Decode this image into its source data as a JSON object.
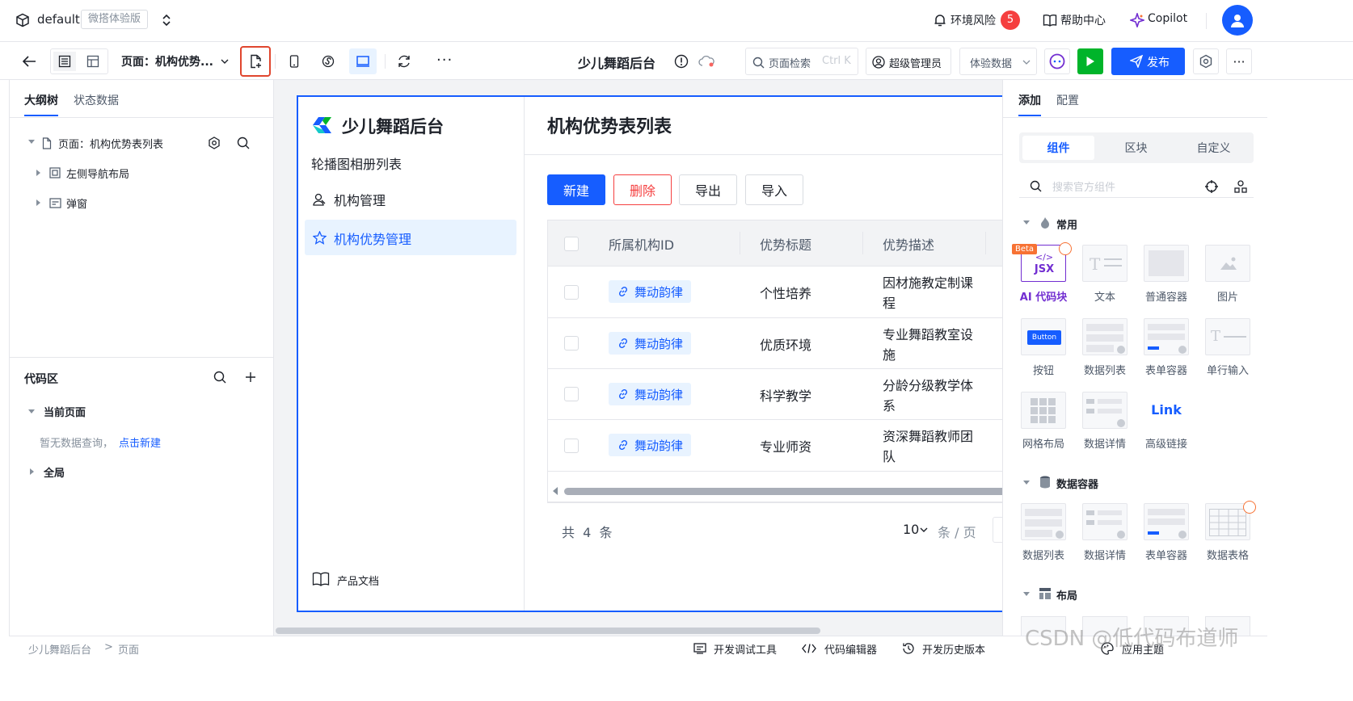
{
  "topbar": {
    "env_name": "default",
    "env_badge": "微搭体验版",
    "risk_label": "环境风险",
    "risk_count": "5",
    "help_label": "帮助中心",
    "copilot_label": "Copilot",
    "brand_color": "#165dff",
    "danger_color": "#f53f3f"
  },
  "toolbar": {
    "page_select": "页面：机构优势...",
    "app_title": "少儿舞蹈后台",
    "search_placeholder": "页面检索",
    "search_shortcut": "Ctrl K",
    "role_label": "超级管理员",
    "data_mode": "体验数据",
    "publish_label": "发布",
    "more": "···"
  },
  "left": {
    "tabs": [
      "大纲树",
      "状态数据"
    ],
    "tree_page": "页面：机构优势表列表",
    "tree_items": [
      "左侧导航布局",
      "弹窗"
    ],
    "code_title": "代码区",
    "current_page": "当前页面",
    "empty_hint": "暂无数据查询，",
    "empty_link": "点击新建",
    "global_label": "全局"
  },
  "preview": {
    "logo_text": "少儿舞蹈后台",
    "nav": [
      "轮播图相册列表",
      "机构管理",
      "机构优势管理"
    ],
    "doc_link": "产品文档",
    "page_title": "机构优势表列表",
    "actions": {
      "new": "新建",
      "delete": "删除",
      "export": "导出",
      "import": "导入"
    },
    "columns": [
      "所属机构ID",
      "优势标题",
      "优势描述"
    ],
    "rows": [
      {
        "org": "舞动韵律",
        "title": "个性培养",
        "desc1": "因材施教定制课",
        "desc2": "程"
      },
      {
        "org": "舞动韵律",
        "title": "优质环境",
        "desc1": "专业舞蹈教室设",
        "desc2": "施"
      },
      {
        "org": "舞动韵律",
        "title": "科学教学",
        "desc1": "分龄分级教学体",
        "desc2": "系"
      },
      {
        "org": "舞动韵律",
        "title": "专业师资",
        "desc1": "资深舞蹈教师团",
        "desc2": "队"
      }
    ],
    "total": "共  4  条",
    "page_size": "10",
    "page_unit": "条 / 页"
  },
  "right": {
    "tabs": [
      "添加",
      "配置"
    ],
    "seg": [
      "组件",
      "区块",
      "自定义"
    ],
    "search_placeholder": "搜索官方组件",
    "group_common": "常用",
    "group_data": "数据容器",
    "group_layout": "布局",
    "common": [
      "AI 代码块",
      "文本",
      "普通容器",
      "图片",
      "按钮",
      "数据列表",
      "表单容器",
      "单行输入",
      "网格布局",
      "数据详情",
      "高级链接"
    ],
    "data": [
      "数据列表",
      "数据详情",
      "表单容器",
      "数据表格"
    ],
    "beta": "Beta",
    "jsx": "JSX",
    "button_thumb": "Button",
    "link_thumb": "Link"
  },
  "status": {
    "breadcrumb": [
      "少儿舞蹈后台",
      "页面"
    ],
    "tools": [
      "开发调试工具",
      "代码编辑器",
      "开发历史版本",
      "应用主题"
    ],
    "watermark": "CSDN @低代码布道师"
  }
}
